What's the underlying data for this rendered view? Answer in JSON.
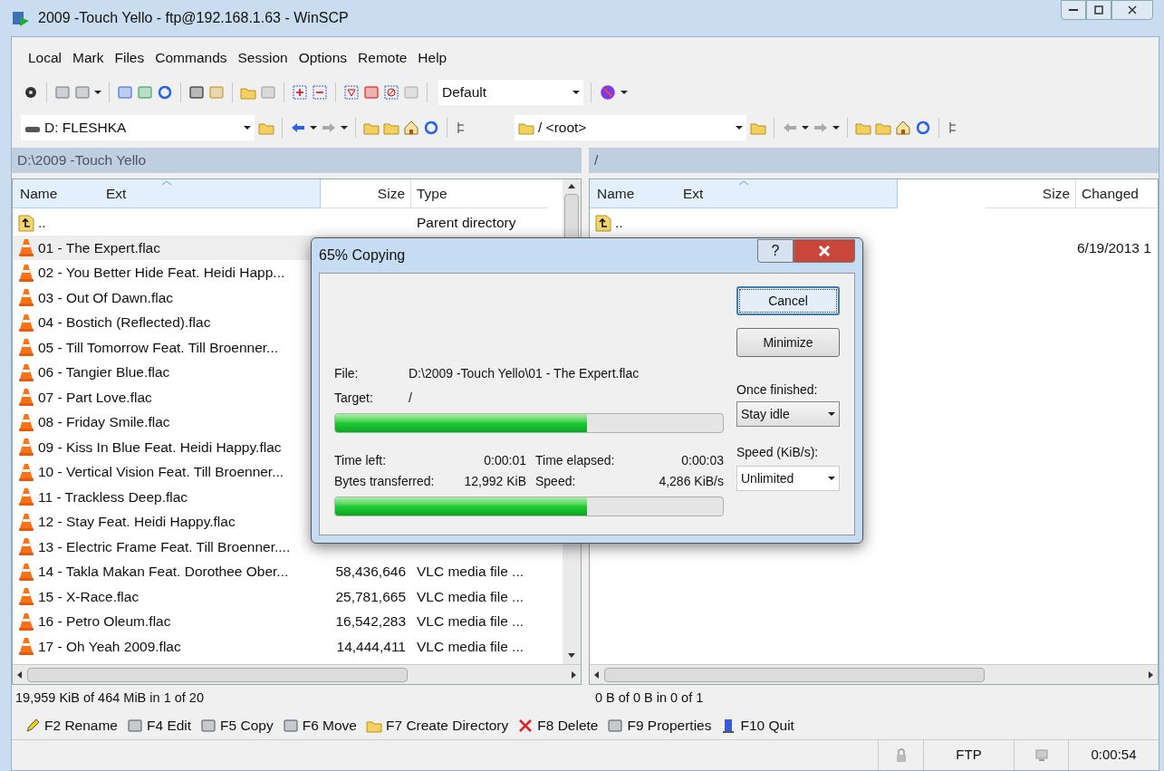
{
  "window": {
    "title": "2009 -Touch Yello - ftp@192.168.1.63 - WinSCP"
  },
  "menu": [
    "Local",
    "Mark",
    "Files",
    "Commands",
    "Session",
    "Options",
    "Remote",
    "Help"
  ],
  "toolbar": {
    "profile": "Default"
  },
  "left": {
    "drive": "D: FLESHKA",
    "path": "D:\\2009 -Touch Yello",
    "columns": [
      "Name",
      "Ext",
      "Size",
      "Type"
    ],
    "rows": [
      {
        "kind": "parent",
        "name": "..",
        "type": "Parent directory",
        "selected": false
      },
      {
        "kind": "file",
        "name": "01 - The Expert.flac",
        "selected": true
      },
      {
        "kind": "file",
        "name": "02 - You Better Hide Feat. Heidi Happ...",
        "selected": false
      },
      {
        "kind": "file",
        "name": "03 - Out Of Dawn.flac",
        "selected": false
      },
      {
        "kind": "file",
        "name": "04 - Bostich (Reflected).flac",
        "selected": false
      },
      {
        "kind": "file",
        "name": "05 - Till Tomorrow Feat. Till Broenner...",
        "selected": false
      },
      {
        "kind": "file",
        "name": "06 - Tangier Blue.flac",
        "selected": false
      },
      {
        "kind": "file",
        "name": "07 - Part Love.flac",
        "selected": false
      },
      {
        "kind": "file",
        "name": "08 - Friday Smile.flac",
        "selected": false
      },
      {
        "kind": "file",
        "name": "09 - Kiss In Blue Feat. Heidi Happy.flac",
        "selected": false
      },
      {
        "kind": "file",
        "name": "10 - Vertical Vision Feat. Till Broenner...",
        "selected": false
      },
      {
        "kind": "file",
        "name": "11 - Trackless Deep.flac",
        "selected": false
      },
      {
        "kind": "file",
        "name": "12 - Stay Feat. Heidi Happy.flac",
        "selected": false
      },
      {
        "kind": "file",
        "name": "13 - Electric Frame Feat. Till Broenner....",
        "selected": false
      },
      {
        "kind": "file",
        "name": "14 - Takla Makan Feat. Dorothee Ober...",
        "size": "58,436,646",
        "type": "VLC media file ...",
        "selected": false
      },
      {
        "kind": "file",
        "name": "15 - X-Race.flac",
        "size": "25,781,665",
        "type": "VLC media file ...",
        "selected": false
      },
      {
        "kind": "file",
        "name": "16 - Petro Oleum.flac",
        "size": "16,542,283",
        "type": "VLC media file ...",
        "selected": false
      },
      {
        "kind": "file",
        "name": "17 - Oh Yeah 2009.flac",
        "size": "14,444,411",
        "type": "VLC media file ...",
        "selected": false
      }
    ],
    "status": "19,959 KiB of 464 MiB in 1 of 20"
  },
  "right": {
    "drive": "/ <root>",
    "path": "/",
    "columns": [
      "Name",
      "Ext",
      "Size",
      "Changed"
    ],
    "rows": [
      {
        "kind": "parent",
        "name": "..",
        "selected": false
      },
      {
        "changed": "6/19/2013 1",
        "selected": false
      }
    ],
    "status": "0 B of 0 B in 0 of 1"
  },
  "function_keys": [
    "F2 Rename",
    "F4 Edit",
    "F5 Copy",
    "F6 Move",
    "F7 Create Directory",
    "F8 Delete",
    "F9 Properties",
    "F10 Quit"
  ],
  "status_bar": {
    "protocol": "FTP",
    "elapsed": "0:00:54"
  },
  "dialog": {
    "title": "65% Copying",
    "help": "?",
    "buttons": [
      "Cancel",
      "Minimize"
    ],
    "file_label": "File:",
    "file": "D:\\2009 -Touch Yello\\01 - The Expert.flac",
    "target_label": "Target:",
    "target": "/",
    "file_progress": {
      "level": 0.65
    },
    "stats": [
      {
        "label": "Time left:",
        "value": "0:00:01"
      },
      {
        "label": "Time elapsed:",
        "value": "0:00:03"
      },
      {
        "label": "Bytes transferred:",
        "value": "12,992 KiB"
      },
      {
        "label": "Speed:",
        "value": "4,286 KiB/s"
      }
    ],
    "total_progress": {
      "level": 0.65
    },
    "once_finished_label": "Once finished:",
    "once_finished": "Stay idle",
    "speed_label": "Speed (KiB/s):",
    "speed": "Unlimited"
  }
}
